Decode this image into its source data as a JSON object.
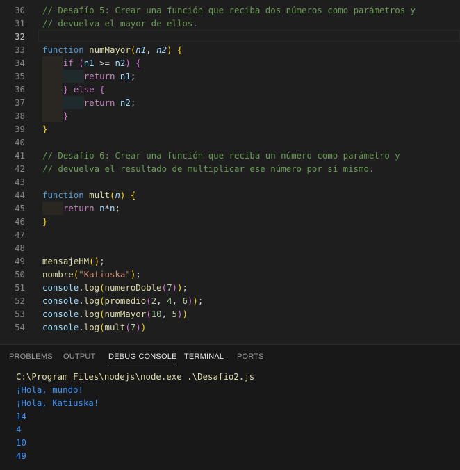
{
  "editor": {
    "lines": [
      {
        "n": "30",
        "parts": [
          {
            "t": "// Desafío 5: Crear una función que reciba dos números como parámetros y",
            "c": "c-com"
          }
        ]
      },
      {
        "n": "31",
        "parts": [
          {
            "t": "// devuelva el mayor de ellos.",
            "c": "c-com"
          }
        ]
      },
      {
        "n": "32",
        "parts": [],
        "active": true
      },
      {
        "n": "33",
        "parts": [
          {
            "t": "function ",
            "c": "c-kwd"
          },
          {
            "t": "numMayor",
            "c": "c-fn"
          },
          {
            "t": "(",
            "c": "b1"
          },
          {
            "t": "n1",
            "c": "c-par"
          },
          {
            "t": ", ",
            "c": ""
          },
          {
            "t": "n2",
            "c": "c-par"
          },
          {
            "t": ")",
            "c": "b1"
          },
          {
            "t": " ",
            "c": ""
          },
          {
            "t": "{",
            "c": "b1"
          }
        ]
      },
      {
        "n": "34",
        "indent": 1,
        "parts": [
          {
            "t": "    "
          },
          {
            "t": "if",
            "c": "c-kw"
          },
          {
            "t": " "
          },
          {
            "t": "(",
            "c": "b2"
          },
          {
            "t": "n1",
            "c": "c-var"
          },
          {
            "t": " >= "
          },
          {
            "t": "n2",
            "c": "c-var"
          },
          {
            "t": ")",
            "c": "b2"
          },
          {
            "t": " "
          },
          {
            "t": "{",
            "c": "b2"
          }
        ]
      },
      {
        "n": "35",
        "indent": 2,
        "parts": [
          {
            "t": "        "
          },
          {
            "t": "return",
            "c": "c-kw"
          },
          {
            "t": " "
          },
          {
            "t": "n1",
            "c": "c-var"
          },
          {
            "t": ";"
          }
        ]
      },
      {
        "n": "36",
        "indent": 1,
        "parts": [
          {
            "t": "    "
          },
          {
            "t": "}",
            "c": "b2"
          },
          {
            "t": " "
          },
          {
            "t": "else",
            "c": "c-kw"
          },
          {
            "t": " "
          },
          {
            "t": "{",
            "c": "b2"
          }
        ]
      },
      {
        "n": "37",
        "indent": 2,
        "parts": [
          {
            "t": "        "
          },
          {
            "t": "return",
            "c": "c-kw"
          },
          {
            "t": " "
          },
          {
            "t": "n2",
            "c": "c-var"
          },
          {
            "t": ";"
          }
        ]
      },
      {
        "n": "38",
        "indent": 1,
        "parts": [
          {
            "t": "    "
          },
          {
            "t": "}",
            "c": "b2"
          }
        ]
      },
      {
        "n": "39",
        "parts": [
          {
            "t": "}",
            "c": "b1"
          }
        ]
      },
      {
        "n": "40",
        "parts": []
      },
      {
        "n": "41",
        "parts": [
          {
            "t": "// Desafío 6: Crear una función que reciba un número como parámetro y",
            "c": "c-com"
          }
        ]
      },
      {
        "n": "42",
        "parts": [
          {
            "t": "// devuelva el resultado de multiplicar ese número por sí mismo.",
            "c": "c-com"
          }
        ]
      },
      {
        "n": "43",
        "parts": []
      },
      {
        "n": "44",
        "parts": [
          {
            "t": "function ",
            "c": "c-kwd"
          },
          {
            "t": "mult",
            "c": "c-fn"
          },
          {
            "t": "(",
            "c": "b1"
          },
          {
            "t": "n",
            "c": "c-par"
          },
          {
            "t": ")",
            "c": "b1"
          },
          {
            "t": " "
          },
          {
            "t": "{",
            "c": "b1"
          }
        ]
      },
      {
        "n": "45",
        "indent": 1,
        "parts": [
          {
            "t": "    "
          },
          {
            "t": "return",
            "c": "c-kw"
          },
          {
            "t": " "
          },
          {
            "t": "n",
            "c": "c-var"
          },
          {
            "t": "*"
          },
          {
            "t": "n",
            "c": "c-var"
          },
          {
            "t": ";"
          }
        ]
      },
      {
        "n": "46",
        "parts": [
          {
            "t": "}",
            "c": "b1"
          }
        ]
      },
      {
        "n": "47",
        "parts": []
      },
      {
        "n": "48",
        "parts": []
      },
      {
        "n": "49",
        "parts": [
          {
            "t": "mensajeHM",
            "c": "c-fn"
          },
          {
            "t": "()",
            "c": "b1"
          },
          {
            "t": ";"
          }
        ]
      },
      {
        "n": "50",
        "parts": [
          {
            "t": "nombre",
            "c": "c-fn"
          },
          {
            "t": "(",
            "c": "b1"
          },
          {
            "t": "\"Katiuska\"",
            "c": "c-str"
          },
          {
            "t": ")",
            "c": "b1"
          },
          {
            "t": ";"
          }
        ]
      },
      {
        "n": "51",
        "parts": [
          {
            "t": "console",
            "c": "c-var"
          },
          {
            "t": "."
          },
          {
            "t": "log",
            "c": "c-fn"
          },
          {
            "t": "(",
            "c": "b1"
          },
          {
            "t": "numeroDoble",
            "c": "c-fn"
          },
          {
            "t": "(",
            "c": "b2"
          },
          {
            "t": "7",
            "c": "c-num"
          },
          {
            "t": ")",
            "c": "b2"
          },
          {
            "t": ")",
            "c": "b1"
          },
          {
            "t": ";"
          }
        ]
      },
      {
        "n": "52",
        "parts": [
          {
            "t": "console",
            "c": "c-var"
          },
          {
            "t": "."
          },
          {
            "t": "log",
            "c": "c-fn"
          },
          {
            "t": "(",
            "c": "b1"
          },
          {
            "t": "promedio",
            "c": "c-fn"
          },
          {
            "t": "(",
            "c": "b2"
          },
          {
            "t": "2",
            "c": "c-num"
          },
          {
            "t": ", "
          },
          {
            "t": "4",
            "c": "c-num"
          },
          {
            "t": ", "
          },
          {
            "t": "6",
            "c": "c-num"
          },
          {
            "t": ")",
            "c": "b2"
          },
          {
            "t": ")",
            "c": "b1"
          },
          {
            "t": ";"
          }
        ]
      },
      {
        "n": "53",
        "parts": [
          {
            "t": "console",
            "c": "c-var"
          },
          {
            "t": "."
          },
          {
            "t": "log",
            "c": "c-fn"
          },
          {
            "t": "(",
            "c": "b1"
          },
          {
            "t": "numMayor",
            "c": "c-fn"
          },
          {
            "t": "(",
            "c": "b2"
          },
          {
            "t": "10",
            "c": "c-num"
          },
          {
            "t": ", "
          },
          {
            "t": "5",
            "c": "c-num"
          },
          {
            "t": ")",
            "c": "b2"
          },
          {
            "t": ")",
            "c": "b1"
          }
        ]
      },
      {
        "n": "54",
        "parts": [
          {
            "t": "console",
            "c": "c-var"
          },
          {
            "t": "."
          },
          {
            "t": "log",
            "c": "c-fn"
          },
          {
            "t": "(",
            "c": "b1"
          },
          {
            "t": "mult",
            "c": "c-fn"
          },
          {
            "t": "(",
            "c": "b2"
          },
          {
            "t": "7",
            "c": "c-num"
          },
          {
            "t": ")",
            "c": "b2"
          },
          {
            "t": ")",
            "c": "b1"
          }
        ]
      }
    ]
  },
  "panel": {
    "tabs": [
      {
        "label": "PROBLEMS",
        "active": false
      },
      {
        "label": "OUTPUT",
        "active": false
      },
      {
        "label": "DEBUG CONSOLE",
        "active": true
      },
      {
        "label": "TERMINAL",
        "active": false
      },
      {
        "label": "PORTS",
        "active": false
      }
    ],
    "command": "C:\\Program Files\\nodejs\\node.exe .\\Desafio2.js",
    "output": [
      "¡Hola, mundo!",
      "¡Hola, Katiuska!",
      "14",
      "4",
      "10",
      "49"
    ]
  },
  "colors": {
    "background": "#1e1e1e",
    "comment": "#6a9955",
    "keyword": "#c586c0",
    "function": "#dcdcaa",
    "variable": "#9cdcfe",
    "string": "#ce9178",
    "number": "#b5cea8",
    "console_output": "#3794ff"
  }
}
